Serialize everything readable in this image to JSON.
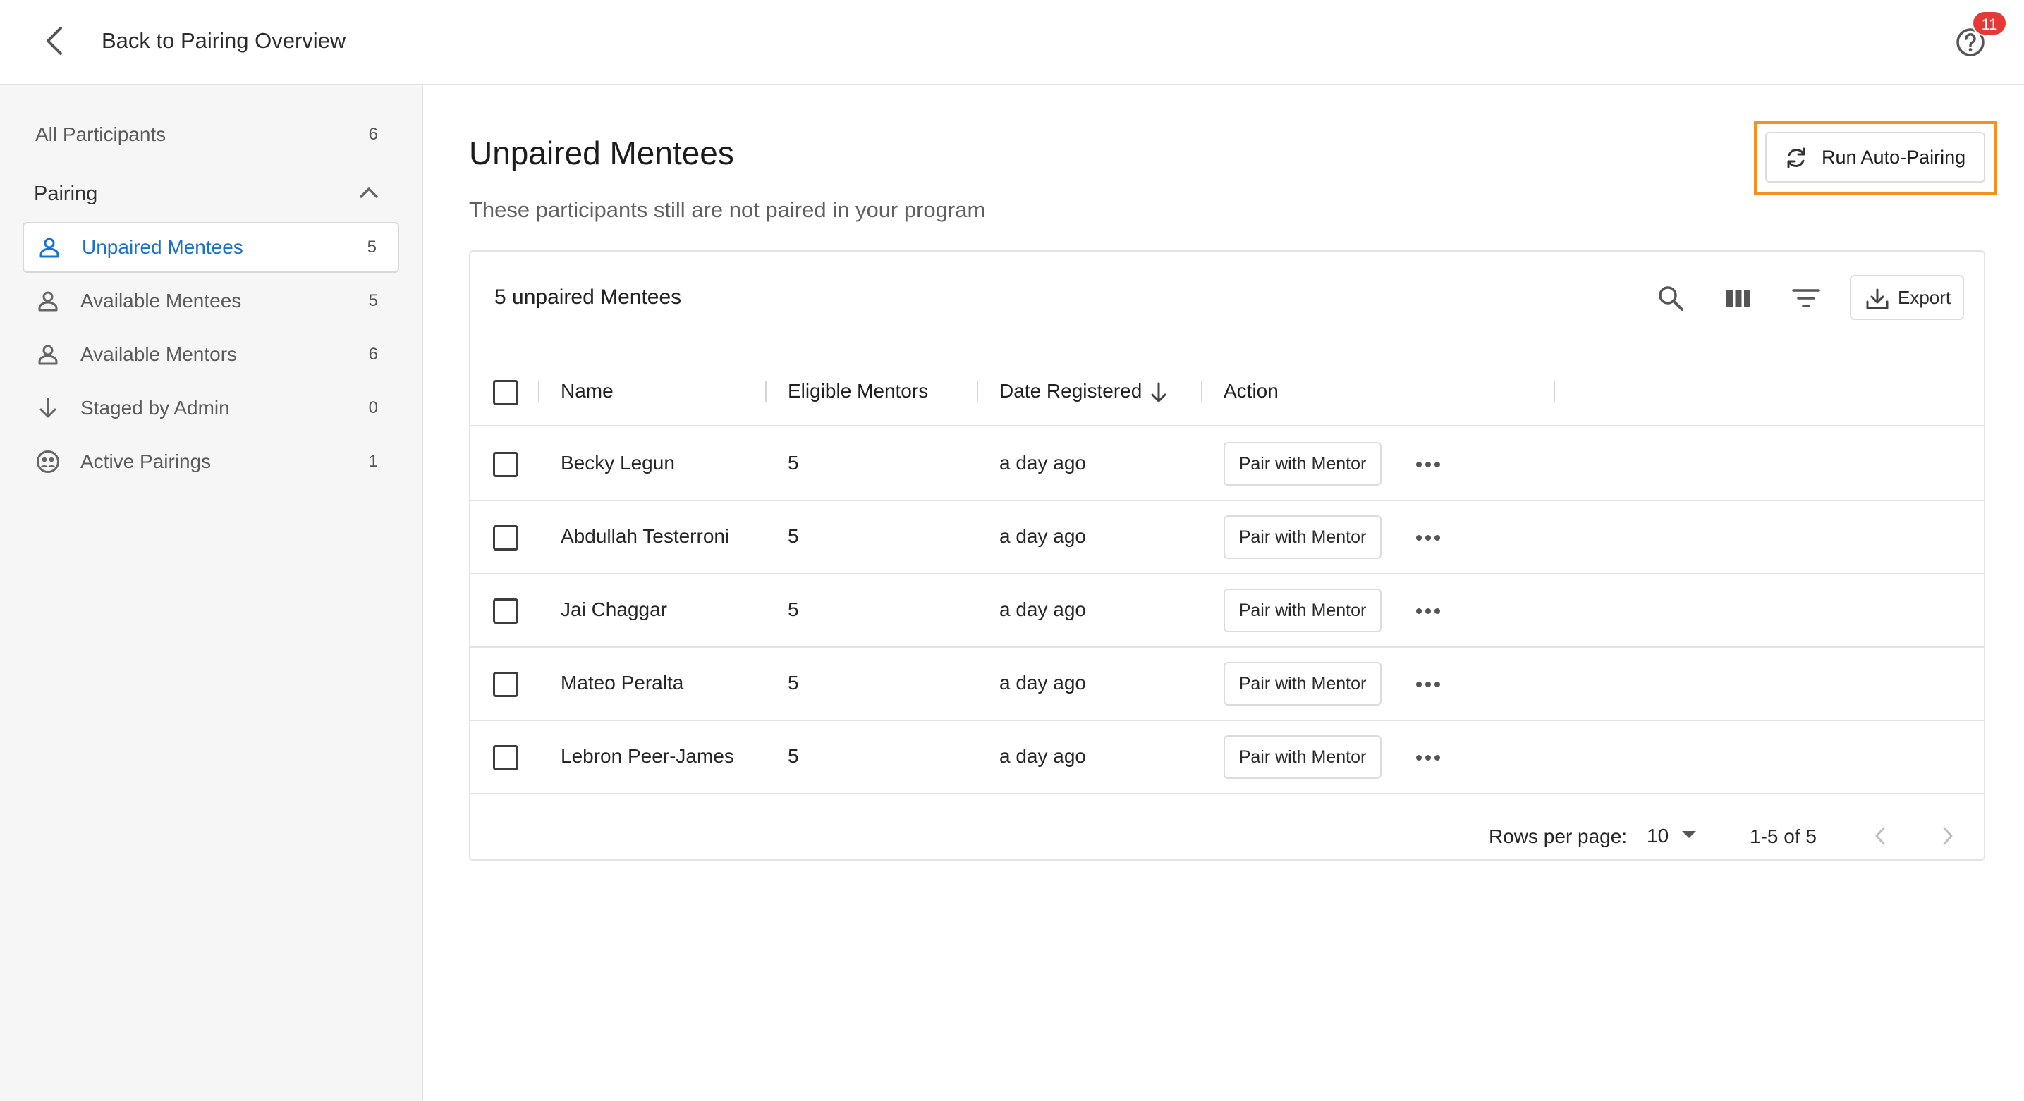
{
  "topbar": {
    "back_label": "Back to Pairing Overview",
    "help_badge": "11"
  },
  "sidebar": {
    "all_participants": {
      "label": "All Participants",
      "count": "6"
    },
    "section": "Pairing",
    "items": [
      {
        "label": "Unpaired Mentees",
        "count": "5",
        "icon": "person-icon",
        "active": true
      },
      {
        "label": "Available Mentees",
        "count": "5",
        "icon": "person-icon",
        "active": false
      },
      {
        "label": "Available Mentors",
        "count": "6",
        "icon": "person-icon",
        "active": false
      },
      {
        "label": "Staged by Admin",
        "count": "0",
        "icon": "arrow-down-icon",
        "active": false
      },
      {
        "label": "Active Pairings",
        "count": "1",
        "icon": "pairing-icon",
        "active": false
      }
    ]
  },
  "main": {
    "title": "Unpaired Mentees",
    "subtitle": "These participants still are not paired in your program",
    "auto_pairing_label": "Run Auto-Pairing"
  },
  "table": {
    "title": "5 unpaired Mentees",
    "export_label": "Export",
    "columns": {
      "name": "Name",
      "eligible": "Eligible Mentors",
      "date": "Date Registered",
      "action": "Action"
    },
    "rows": [
      {
        "name": "Becky Legun",
        "eligible": "5",
        "date": "a day ago",
        "action": "Pair with Mentor"
      },
      {
        "name": "Abdullah Testerroni",
        "eligible": "5",
        "date": "a day ago",
        "action": "Pair with Mentor"
      },
      {
        "name": "Jai Chaggar",
        "eligible": "5",
        "date": "a day ago",
        "action": "Pair with Mentor"
      },
      {
        "name": "Mateo Peralta",
        "eligible": "5",
        "date": "a day ago",
        "action": "Pair with Mentor"
      },
      {
        "name": "Lebron Peer-James",
        "eligible": "5",
        "date": "a day ago",
        "action": "Pair with Mentor"
      }
    ],
    "footer": {
      "rows_per_page_label": "Rows per page:",
      "rows_per_page_value": "10",
      "range": "1-5 of 5"
    }
  },
  "colors": {
    "accent": "#1a6fd1",
    "highlight": "#f39223",
    "badge": "#e53935"
  }
}
